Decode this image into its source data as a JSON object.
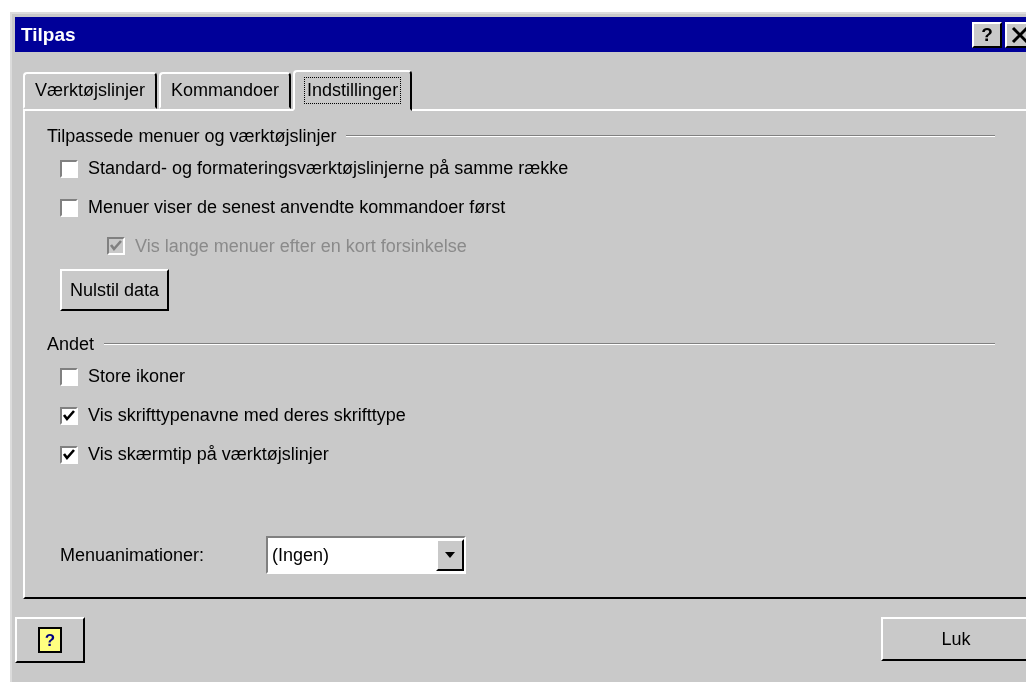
{
  "window": {
    "title": "Tilpas",
    "help_button": "?"
  },
  "tabs": [
    {
      "label": "Værktøjslinjer",
      "selected": false
    },
    {
      "label": "Kommandoer",
      "selected": false
    },
    {
      "label": "Indstillinger",
      "selected": true
    }
  ],
  "groups": [
    {
      "title": "Tilpassede menuer og værktøjslinjer",
      "items": [
        {
          "kind": "checkbox",
          "label": "Standard- og formateringsværktøjslinjerne på samme række",
          "checked": false,
          "disabled": false,
          "indented": false
        },
        {
          "kind": "checkbox",
          "label": "Menuer viser de senest anvendte kommandoer først",
          "checked": false,
          "disabled": false,
          "indented": false
        },
        {
          "kind": "checkbox",
          "label": "Vis lange menuer efter en kort forsinkelse",
          "checked": true,
          "disabled": true,
          "indented": true
        },
        {
          "kind": "button",
          "label": "Nulstil data"
        }
      ]
    },
    {
      "title": "Andet",
      "items": [
        {
          "kind": "checkbox",
          "label": "Store ikoner",
          "checked": false,
          "disabled": false,
          "indented": false
        },
        {
          "kind": "checkbox",
          "label": "Vis skrifttypenavne med deres skrifttype",
          "checked": true,
          "disabled": false,
          "indented": false
        },
        {
          "kind": "checkbox",
          "label": "Vis skærmtip på værktøjslinjer",
          "checked": true,
          "disabled": false,
          "indented": false
        }
      ]
    }
  ],
  "menu_animation": {
    "label": "Menuanimationer:",
    "value": "(Ingen)"
  },
  "footer": {
    "help": "?",
    "close": "Luk"
  }
}
